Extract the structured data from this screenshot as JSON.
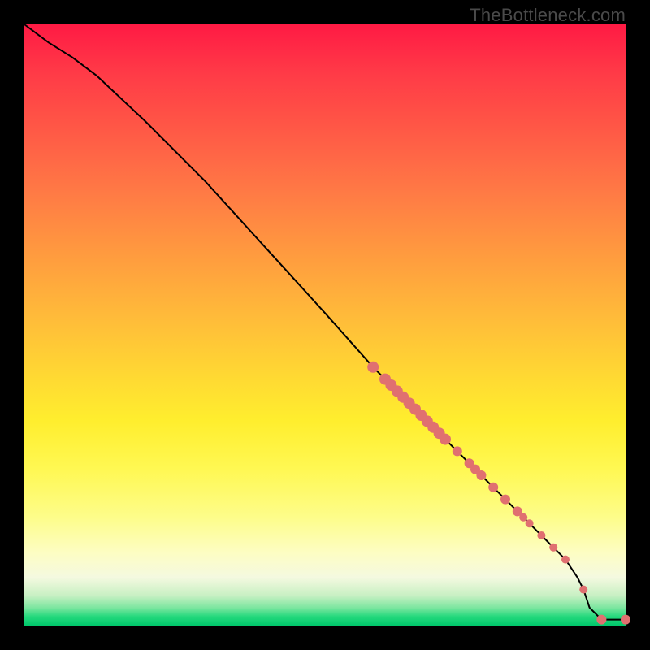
{
  "attribution": "TheBottleneck.com",
  "colors": {
    "curve_stroke": "#000000",
    "marker_fill": "#e07070",
    "marker_stroke": "#c85f5f"
  },
  "chart_data": {
    "type": "line",
    "title": "",
    "xlabel": "",
    "ylabel": "",
    "xlim": [
      0,
      100
    ],
    "ylim": [
      0,
      100
    ],
    "description": "Diagonal bottleneck curve descending from top-left (100) to bottom-right (~0) with a dense cluster of markers in the lower-right portion of the curve, over a vertical heat gradient (red=high, green=low).",
    "series": [
      {
        "name": "bottleneck-curve",
        "x": [
          0,
          4,
          8,
          12,
          20,
          30,
          40,
          50,
          58,
          60,
          62,
          64,
          66,
          68,
          70,
          72,
          74,
          76,
          78,
          80,
          82,
          84,
          86,
          88,
          90,
          92,
          93,
          94,
          96,
          100
        ],
        "y": [
          100,
          97,
          94.5,
          91.5,
          84,
          74,
          63,
          52,
          43,
          41,
          39,
          37,
          35,
          33,
          31,
          29,
          27,
          25,
          23,
          21,
          19,
          17,
          15,
          13,
          11,
          8,
          6,
          3,
          1,
          1
        ]
      }
    ],
    "markers": {
      "name": "data-points",
      "x": [
        58,
        60,
        61,
        62,
        63,
        64,
        65,
        66,
        67,
        68,
        69,
        70,
        72,
        74,
        75,
        76,
        78,
        80,
        82,
        83,
        84,
        86,
        88,
        90,
        93,
        96,
        100
      ],
      "y": [
        43,
        41,
        40,
        39,
        38,
        37,
        36,
        35,
        34,
        33,
        32,
        31,
        29,
        27,
        26,
        25,
        23,
        21,
        19,
        18,
        17,
        15,
        13,
        11,
        6,
        1,
        1
      ],
      "r": [
        7,
        7,
        7,
        7,
        7,
        7,
        7,
        7,
        7,
        7,
        7,
        7,
        6,
        6,
        6,
        6,
        6,
        6,
        6,
        5,
        5,
        5,
        5,
        5,
        5,
        6,
        6
      ]
    }
  }
}
